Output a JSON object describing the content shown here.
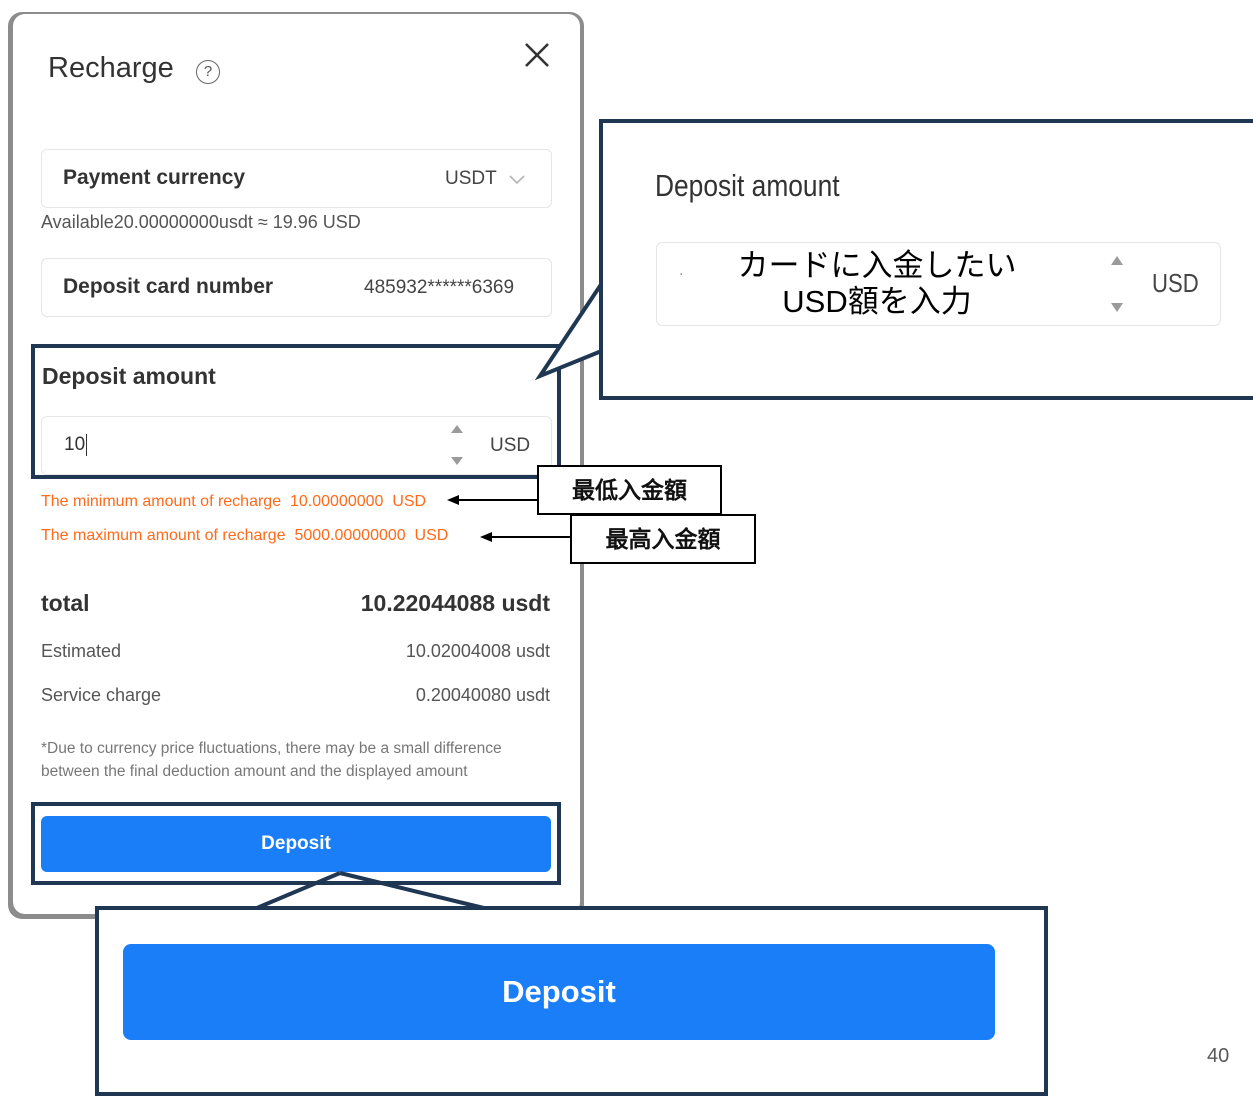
{
  "modal": {
    "title": "Recharge",
    "help_icon": "?",
    "payment_currency": {
      "label": "Payment currency",
      "value": "USDT"
    },
    "available": "Available20.00000000usdt ≈ 19.96 USD",
    "deposit_card": {
      "label": "Deposit card number",
      "value": "485932******6369"
    },
    "deposit_amount": {
      "label": "Deposit amount",
      "value": "10",
      "unit": "USD"
    },
    "min_note": "The minimum amount of recharge  10.00000000  USD",
    "max_note": "The maximum amount of recharge  5000.00000000  USD",
    "total": {
      "label": "total",
      "value": "10.22044088 usdt"
    },
    "estimated": {
      "label": "Estimated",
      "value": "10.02004008 usdt"
    },
    "service_charge": {
      "label": "Service charge",
      "value": "0.20040080 usdt"
    },
    "disclaimer": "*Due to currency price fluctuations, there may be a small difference between the final deduction amount and the displayed amount",
    "deposit_button": "Deposit"
  },
  "callout_amount": {
    "label": "Deposit amount",
    "placeholder_dot": ".",
    "overlay_text_line1": "カードに入金したい",
    "overlay_text_line2": "USD額を入力",
    "unit": "USD"
  },
  "tags": {
    "min_label": "最低入金額",
    "max_label": "最高入金額"
  },
  "callout_button": {
    "label": "Deposit"
  },
  "page_number": "40",
  "colors": {
    "accent": "#1a7ef8",
    "error": "#ff6a1a",
    "highlight_border": "#1f3752"
  }
}
